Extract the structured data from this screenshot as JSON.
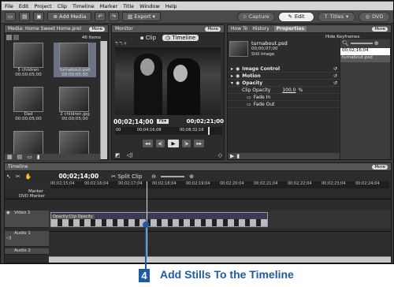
{
  "menu": [
    "File",
    "Edit",
    "Project",
    "Clip",
    "Timeline",
    "Marker",
    "Title",
    "Window",
    "Help"
  ],
  "toolbar": {
    "add_media": "Add Media",
    "export": "Export"
  },
  "modes": {
    "capture": "Capture",
    "edit": "Edit",
    "titles": "Titles",
    "dvd": "DVD"
  },
  "media_panel": {
    "title": "Media: Home Sweet Home.prel",
    "more": "More",
    "count": "46 Items",
    "items": [
      {
        "name": "5 children",
        "time": "00;00;05;00"
      },
      {
        "name": "turnabout.psd",
        "time": "00;00;05;00"
      },
      {
        "name": "Dad",
        "time": "00;00;05;00"
      },
      {
        "name": "2 children.jpg",
        "time": "00;00;05;00"
      }
    ]
  },
  "monitor": {
    "title": "Monitor",
    "more": "More",
    "tab_clip": "Clip",
    "tab_timeline": "Timeline",
    "current_time": "00;02;14;00",
    "fit": "Fit",
    "duration": "00;02;21;00",
    "ruler": [
      "00",
      "00;04;16;08",
      "00;08;32;16"
    ]
  },
  "right_panel": {
    "tabs": [
      "How To",
      "History",
      "Properties"
    ],
    "more": "More",
    "hide_keyframes": "Hide Keyframes",
    "clip_name": "turnabout.psd",
    "clip_duration": "00;00;07;00",
    "clip_type": "Still Image",
    "kf_time": "00;02;16;04",
    "kf_clip": "turnabout.psd",
    "effects": [
      "Image Control",
      "Motion",
      "Opacity"
    ],
    "opacity_label": "Clip Opacity",
    "opacity_value": "100.0",
    "opacity_unit": "%",
    "fade_in": "Fade In",
    "fade_out": "Fade Out"
  },
  "timeline": {
    "title": "Timeline",
    "more": "More",
    "time": "00;02;14;00",
    "split": "Split Clip",
    "ruler": [
      "00;02;15;04",
      "00;02;16;04",
      "00;02;17;04",
      "00;02;18;04",
      "00;02;19;04",
      "00;02;20;04",
      "00;02;21;04",
      "00;02;22;04",
      "00;02;23;04",
      "00;02;24;04"
    ],
    "marker": "Marker",
    "dvd_marker": "DVD Marker",
    "video1": "Video 1",
    "audio1": "Audio 1",
    "audio2": "Audio 2",
    "clip_label": "Opacity:Clip Opacity"
  },
  "caption": {
    "number": "4",
    "text": "Add Stills To the Timeline"
  },
  "colors": {
    "accent": "#1e5aa8",
    "panel": "#2c2c2c",
    "clip": "#3a3a55"
  }
}
